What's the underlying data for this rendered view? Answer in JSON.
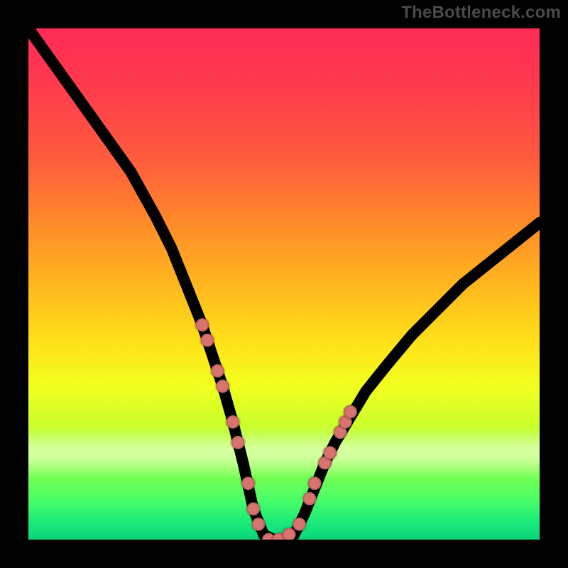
{
  "watermark": "TheBottleneck.com",
  "colors": {
    "frame_background": "#000000",
    "gradient_top": "#ff2b55",
    "gradient_bottom": "#0ad47a",
    "curve_stroke": "#000000",
    "dot_fill": "#d8736f"
  },
  "chart_data": {
    "type": "line",
    "title": "",
    "xlabel": "",
    "ylabel": "",
    "xlim": [
      0,
      100
    ],
    "ylim": [
      0,
      100
    ],
    "grid": false,
    "legend": false,
    "note": "Background encodes a heat gradient (red=high bottleneck at top, green=low at bottom). Black curve shows bottleneck percentage vs. an implicit x-axis; minimum (~0%) occurs around x≈44–52. Salmon dots mark highlighted sample points near the minimum on both branches.",
    "series": [
      {
        "name": "bottleneck_curve",
        "x": [
          0,
          5,
          10,
          15,
          20,
          25,
          28,
          30,
          32,
          34,
          36,
          38,
          40,
          42,
          44,
          46,
          48,
          50,
          52,
          54,
          56,
          58,
          60,
          63,
          66,
          70,
          75,
          80,
          85,
          90,
          95,
          100
        ],
        "y": [
          100,
          93,
          86,
          79,
          72,
          63,
          57,
          52,
          47,
          42,
          36,
          30,
          23,
          15,
          6,
          1,
          0,
          0,
          1,
          5,
          10,
          15,
          19,
          24,
          29,
          34,
          40,
          45,
          50,
          54,
          58,
          62
        ]
      }
    ],
    "highlight_points": {
      "name": "salmon_dots",
      "points": [
        {
          "x": 34,
          "y": 42
        },
        {
          "x": 35,
          "y": 39
        },
        {
          "x": 37,
          "y": 33
        },
        {
          "x": 38,
          "y": 30
        },
        {
          "x": 40,
          "y": 23
        },
        {
          "x": 41,
          "y": 19
        },
        {
          "x": 43,
          "y": 11
        },
        {
          "x": 44,
          "y": 6
        },
        {
          "x": 45,
          "y": 3
        },
        {
          "x": 47,
          "y": 0
        },
        {
          "x": 49,
          "y": 0
        },
        {
          "x": 51,
          "y": 1
        },
        {
          "x": 53,
          "y": 3
        },
        {
          "x": 55,
          "y": 8
        },
        {
          "x": 56,
          "y": 11
        },
        {
          "x": 58,
          "y": 15
        },
        {
          "x": 59,
          "y": 17
        },
        {
          "x": 61,
          "y": 21
        },
        {
          "x": 62,
          "y": 23
        },
        {
          "x": 63,
          "y": 25
        }
      ]
    }
  }
}
